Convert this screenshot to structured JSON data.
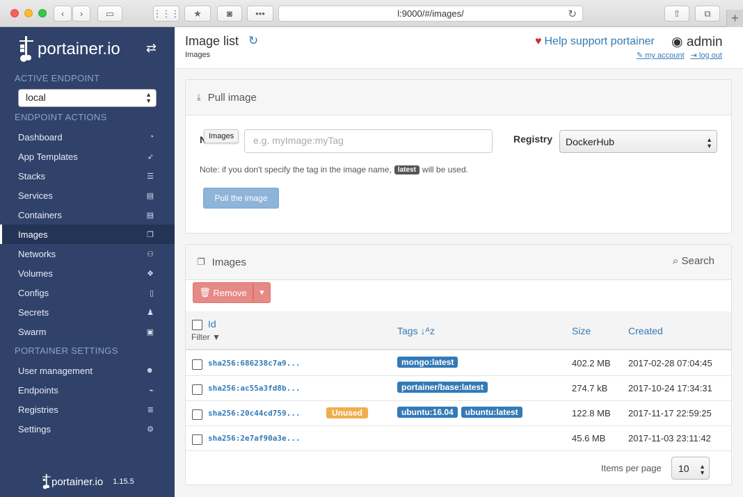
{
  "browser": {
    "url": "l:9000/#/images/"
  },
  "sidebar": {
    "brand": "portainer.io",
    "active_endpoint_title": "ACTIVE ENDPOINT",
    "endpoint_value": "local",
    "endpoint_actions_title": "ENDPOINT ACTIONS",
    "actions": [
      {
        "label": "Dashboard",
        "icon": "tachometer-icon",
        "glyph": "◔"
      },
      {
        "label": "App Templates",
        "icon": "rocket-icon",
        "glyph": "➶"
      },
      {
        "label": "Stacks",
        "icon": "list-icon",
        "glyph": "☰"
      },
      {
        "label": "Services",
        "icon": "list-alt-icon",
        "glyph": "▤"
      },
      {
        "label": "Containers",
        "icon": "server-icon",
        "glyph": "▤"
      },
      {
        "label": "Images",
        "icon": "clone-icon",
        "glyph": "❐"
      },
      {
        "label": "Networks",
        "icon": "sitemap-icon",
        "glyph": "⚇"
      },
      {
        "label": "Volumes",
        "icon": "cubes-icon",
        "glyph": "❖"
      },
      {
        "label": "Configs",
        "icon": "file-code-icon",
        "glyph": "▯"
      },
      {
        "label": "Secrets",
        "icon": "user-secret-icon",
        "glyph": "♟"
      },
      {
        "label": "Swarm",
        "icon": "object-group-icon",
        "glyph": "▣"
      }
    ],
    "settings_title": "PORTAINER SETTINGS",
    "settings": [
      {
        "label": "User management",
        "icon": "users-icon",
        "glyph": "☻"
      },
      {
        "label": "Endpoints",
        "icon": "plug-icon",
        "glyph": "⌁"
      },
      {
        "label": "Registries",
        "icon": "database-icon",
        "glyph": "≣"
      },
      {
        "label": "Settings",
        "icon": "cogs-icon",
        "glyph": "⚙"
      }
    ],
    "footer_brand": "portainer.io",
    "version": "1.15.5"
  },
  "header": {
    "title": "Image list",
    "breadcrumb": "Images",
    "help": "Help support portainer",
    "user": "admin",
    "my_account": "my account",
    "log_out": "log out"
  },
  "pull": {
    "title": "Pull image",
    "name_label": "N",
    "tooltip": "Images",
    "placeholder": "e.g. myImage:myTag",
    "registry_label": "Registry",
    "registry_value": "DockerHub",
    "note_before": "Note: if you don't specify the tag in the image name,",
    "note_tag": "latest",
    "note_after": "will be used.",
    "button": "Pull the image"
  },
  "images": {
    "title": "Images",
    "search": "Search",
    "remove": "Remove",
    "columns": {
      "id": "Id",
      "filter": "Filter",
      "tags": "Tags",
      "size": "Size",
      "created": "Created"
    },
    "rows": [
      {
        "id": "sha256:686238c7a9...",
        "unused": "",
        "tags": [
          "mongo:latest"
        ],
        "size": "402.2 MB",
        "created": "2017-02-28 07:04:45"
      },
      {
        "id": "sha256:ac55a3fd8b...",
        "unused": "",
        "tags": [
          "portainer/base:latest"
        ],
        "size": "274.7 kB",
        "created": "2017-10-24 17:34:31"
      },
      {
        "id": "sha256:20c44cd759...",
        "unused": "Unused",
        "tags": [
          "ubuntu:16.04",
          "ubuntu:latest"
        ],
        "size": "122.8 MB",
        "created": "2017-11-17 22:59:25"
      },
      {
        "id": "sha256:2e7af90a3e...",
        "unused": "",
        "tags": [],
        "size": "45.6 MB",
        "created": "2017-11-03 23:11:42"
      }
    ],
    "items_per_page_label": "Items per page",
    "items_per_page": "10"
  }
}
